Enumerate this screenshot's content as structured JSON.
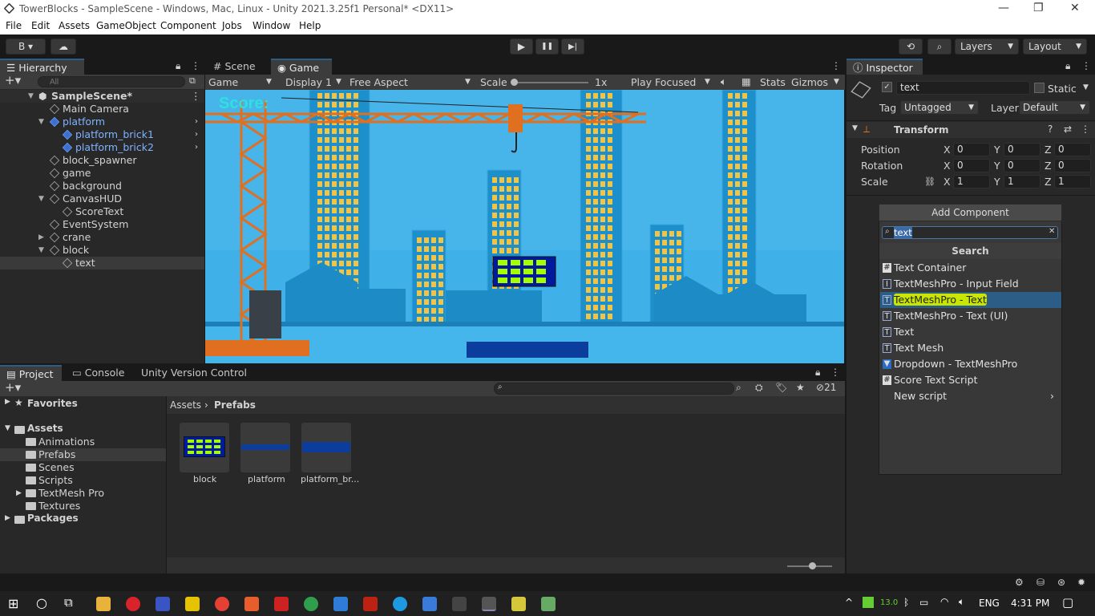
{
  "window": {
    "title": "TowerBlocks - SampleScene - Windows, Mac, Linux - Unity 2021.3.25f1 Personal* <DX11>",
    "min": "—",
    "max": "❐",
    "close": "✕"
  },
  "menu": [
    "File",
    "Edit",
    "Assets",
    "GameObject",
    "Component",
    "Jobs",
    "Window",
    "Help"
  ],
  "toolbar": {
    "account": "B ▾",
    "play": "▶",
    "pause": "❚❚",
    "step": "▶|",
    "layers": "Layers",
    "layout": "Layout"
  },
  "hierarchy": {
    "tab": "Hierarchy",
    "search_placeholder": "All",
    "scene": "SampleScene*",
    "items": [
      {
        "label": "Main Camera",
        "depth": 1,
        "arrow": "",
        "blue": false
      },
      {
        "label": "platform",
        "depth": 1,
        "arrow": "▼",
        "blue": true
      },
      {
        "label": "platform_brick1",
        "depth": 2,
        "arrow": "",
        "blue": true
      },
      {
        "label": "platform_brick2",
        "depth": 2,
        "arrow": "",
        "blue": true
      },
      {
        "label": "block_spawner",
        "depth": 1,
        "arrow": "",
        "blue": false
      },
      {
        "label": "game",
        "depth": 1,
        "arrow": "",
        "blue": false
      },
      {
        "label": "background",
        "depth": 1,
        "arrow": "",
        "blue": false
      },
      {
        "label": "CanvasHUD",
        "depth": 1,
        "arrow": "▼",
        "blue": false
      },
      {
        "label": "ScoreText",
        "depth": 2,
        "arrow": "",
        "blue": false
      },
      {
        "label": "EventSystem",
        "depth": 1,
        "arrow": "",
        "blue": false
      },
      {
        "label": "crane",
        "depth": 1,
        "arrow": "▶",
        "blue": false
      },
      {
        "label": "block",
        "depth": 1,
        "arrow": "▼",
        "blue": false
      },
      {
        "label": "text",
        "depth": 2,
        "arrow": "",
        "blue": false
      }
    ]
  },
  "game_view": {
    "tabs": [
      "Scene",
      "Game"
    ],
    "game_dropdown": "Game",
    "display": "Display 1",
    "aspect": "Free Aspect",
    "scale_label": "Scale",
    "scale_value": "1x",
    "play_mode": "Play Focused",
    "stats": "Stats",
    "gizmos": "Gizmos",
    "score_text": "Score:"
  },
  "project": {
    "tabs": [
      "Project",
      "Console",
      "Unity Version Control"
    ],
    "hidden_count": "21",
    "favorites": "Favorites",
    "assets": "Assets",
    "folders": [
      "Animations",
      "Prefabs",
      "Scenes",
      "Scripts",
      "TextMesh Pro",
      "Textures"
    ],
    "packages": "Packages",
    "breadcrumb": [
      "Assets",
      "Prefabs"
    ],
    "prefabs": [
      "block",
      "platform",
      "platform_br..."
    ]
  },
  "inspector": {
    "tab": "Inspector",
    "object_name": "text",
    "static_label": "Static",
    "tag_label": "Tag",
    "tag_value": "Untagged",
    "layer_label": "Layer",
    "layer_value": "Default",
    "transform": "Transform",
    "position": "Position",
    "rotation": "Rotation",
    "scale": "Scale",
    "pos": [
      "0",
      "0",
      "0"
    ],
    "rot": [
      "0",
      "0",
      "0"
    ],
    "scl": [
      "1",
      "1",
      "1"
    ],
    "axes": [
      "X",
      "Y",
      "Z"
    ],
    "add_component": "Add Component",
    "search_value": "text",
    "search_header": "Search",
    "results": [
      {
        "label": "Text Container",
        "icon": "#"
      },
      {
        "label": "TextMeshPro - Input Field",
        "icon": "I"
      },
      {
        "label": "TextMeshPro - Text",
        "icon": "T"
      },
      {
        "label": "TextMeshPro - Text (UI)",
        "icon": "T"
      },
      {
        "label": "Text",
        "icon": "T"
      },
      {
        "label": "Text Mesh",
        "icon": "T"
      },
      {
        "label": "Dropdown - TextMeshPro",
        "icon": "▼"
      },
      {
        "label": "Score Text Script",
        "icon": "#"
      },
      {
        "label": "New script",
        "icon": ""
      }
    ]
  },
  "taskbar": {
    "lang": "ENG",
    "time": "4:31 PM",
    "temp": "13.0"
  }
}
